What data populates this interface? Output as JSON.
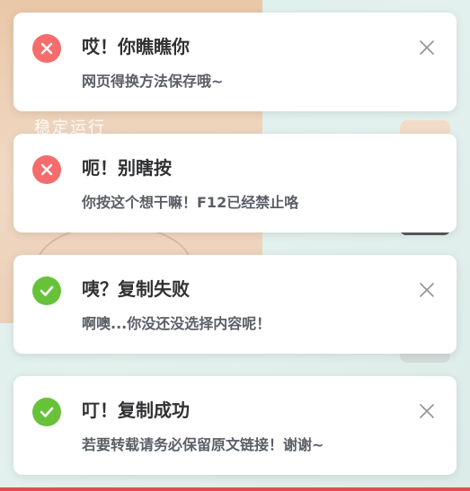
{
  "background": {
    "heading": "稳定运行"
  },
  "notifications": [
    {
      "type": "error",
      "title": "哎！你瞧瞧你",
      "message": "网页得换方法保存哦~"
    },
    {
      "type": "error",
      "title": "呃！别瞎按",
      "message": "你按这个想干嘛！F12已经禁止咯"
    },
    {
      "type": "success",
      "title": "咦？复制失败",
      "message": "啊噢...你没还没选择内容呢！"
    },
    {
      "type": "success",
      "title": "叮！复制成功",
      "message": "若要转载请务必保留原文链接！谢谢~"
    }
  ],
  "icons": {
    "error": "close-circle-icon",
    "success": "check-circle-icon",
    "dismiss": "close-icon"
  },
  "colors": {
    "error": "#f56c6c",
    "success": "#67c23a"
  }
}
